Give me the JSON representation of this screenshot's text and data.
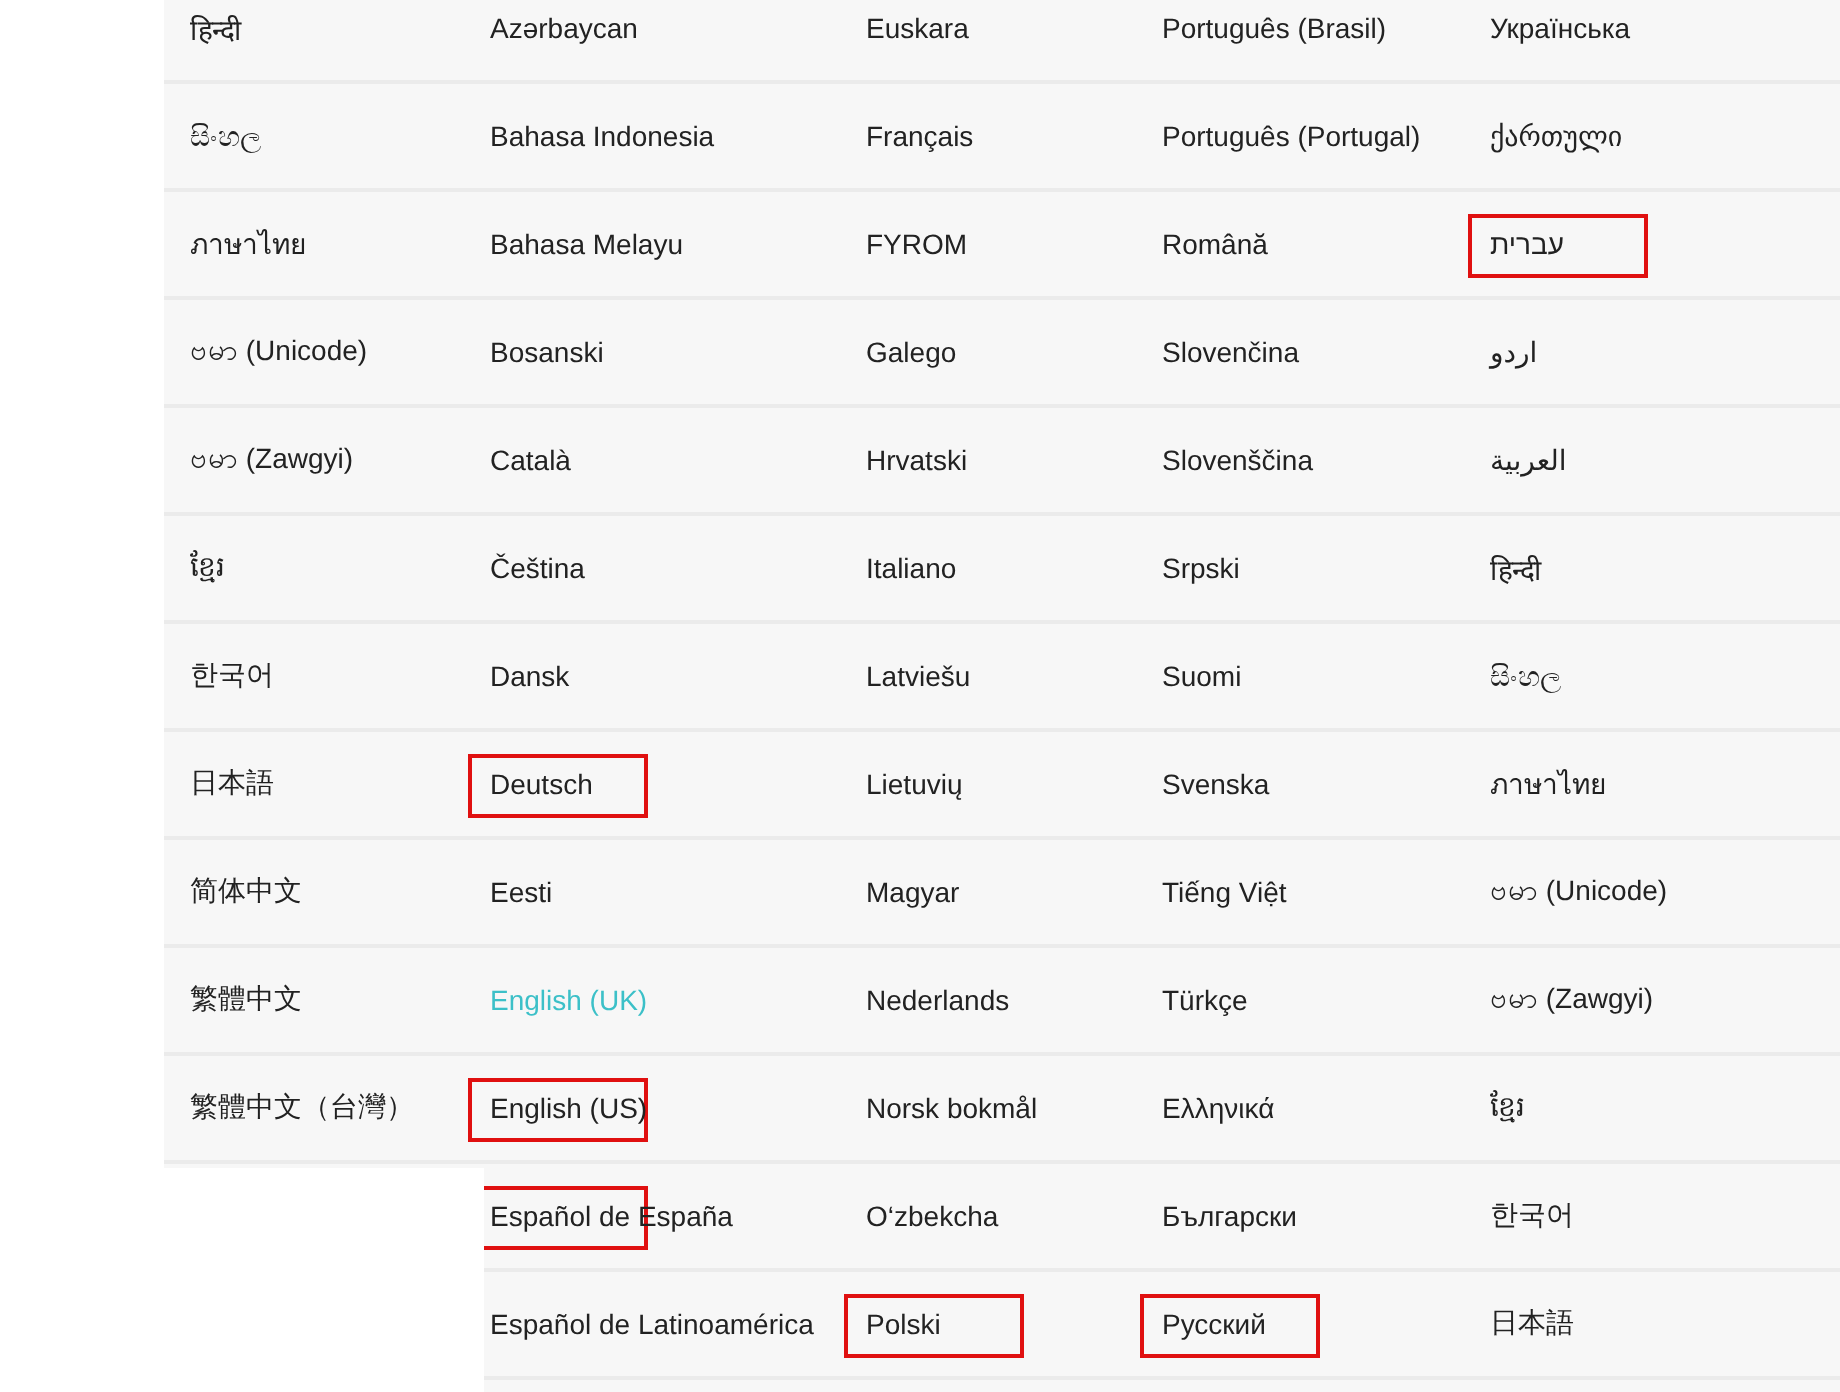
{
  "columns": [
    {
      "items": [
        {
          "label": "हिन्दी",
          "selected": false,
          "highlighted": false
        },
        {
          "label": "සිංහල",
          "selected": false,
          "highlighted": false
        },
        {
          "label": "ภาษาไทย",
          "selected": false,
          "highlighted": false
        },
        {
          "label": "ဗမာ (Unicode)",
          "selected": false,
          "highlighted": false
        },
        {
          "label": "ဗမာ (Zawgyi)",
          "selected": false,
          "highlighted": false
        },
        {
          "label": "ខ្មែរ",
          "selected": false,
          "highlighted": false
        },
        {
          "label": "한국어",
          "selected": false,
          "highlighted": false
        },
        {
          "label": "日本語",
          "selected": false,
          "highlighted": false
        },
        {
          "label": "简体中文",
          "selected": false,
          "highlighted": false
        },
        {
          "label": "繁體中文",
          "selected": false,
          "highlighted": false
        },
        {
          "label": "繁體中文（台灣）",
          "selected": false,
          "highlighted": false
        }
      ]
    },
    {
      "items": [
        {
          "label": "Azərbaycan",
          "selected": false,
          "highlighted": false
        },
        {
          "label": "Bahasa Indonesia",
          "selected": false,
          "highlighted": false
        },
        {
          "label": "Bahasa Melayu",
          "selected": false,
          "highlighted": false
        },
        {
          "label": "Bosanski",
          "selected": false,
          "highlighted": false
        },
        {
          "label": "Català",
          "selected": false,
          "highlighted": false
        },
        {
          "label": "Čeština",
          "selected": false,
          "highlighted": false
        },
        {
          "label": "Dansk",
          "selected": false,
          "highlighted": false
        },
        {
          "label": "Deutsch",
          "selected": false,
          "highlighted": true
        },
        {
          "label": "Eesti",
          "selected": false,
          "highlighted": false
        },
        {
          "label": "English (UK)",
          "selected": true,
          "highlighted": false
        },
        {
          "label": "English (US)",
          "selected": false,
          "highlighted": true
        },
        {
          "label": "Español de España",
          "selected": false,
          "highlighted": true
        },
        {
          "label": "Español de Latinoamérica",
          "selected": false,
          "highlighted": false
        }
      ]
    },
    {
      "items": [
        {
          "label": "Euskara",
          "selected": false,
          "highlighted": false
        },
        {
          "label": "Français",
          "selected": false,
          "highlighted": false
        },
        {
          "label": "FYROM",
          "selected": false,
          "highlighted": false
        },
        {
          "label": "Galego",
          "selected": false,
          "highlighted": false
        },
        {
          "label": "Hrvatski",
          "selected": false,
          "highlighted": false
        },
        {
          "label": "Italiano",
          "selected": false,
          "highlighted": false
        },
        {
          "label": "Latviešu",
          "selected": false,
          "highlighted": false
        },
        {
          "label": "Lietuvių",
          "selected": false,
          "highlighted": false
        },
        {
          "label": "Magyar",
          "selected": false,
          "highlighted": false
        },
        {
          "label": "Nederlands",
          "selected": false,
          "highlighted": false
        },
        {
          "label": "Norsk bokmål",
          "selected": false,
          "highlighted": false
        },
        {
          "label": "O‘zbekcha",
          "selected": false,
          "highlighted": false
        },
        {
          "label": "Polski",
          "selected": false,
          "highlighted": true
        }
      ]
    },
    {
      "items": [
        {
          "label": "Português (Brasil)",
          "selected": false,
          "highlighted": false
        },
        {
          "label": "Português (Portugal)",
          "selected": false,
          "highlighted": false
        },
        {
          "label": "Română",
          "selected": false,
          "highlighted": false
        },
        {
          "label": "Slovenčina",
          "selected": false,
          "highlighted": false
        },
        {
          "label": "Slovenščina",
          "selected": false,
          "highlighted": false
        },
        {
          "label": "Srpski",
          "selected": false,
          "highlighted": false
        },
        {
          "label": "Suomi",
          "selected": false,
          "highlighted": false
        },
        {
          "label": "Svenska",
          "selected": false,
          "highlighted": false
        },
        {
          "label": "Tiếng Việt",
          "selected": false,
          "highlighted": false
        },
        {
          "label": "Türkçe",
          "selected": false,
          "highlighted": false
        },
        {
          "label": "Ελληνικά",
          "selected": false,
          "highlighted": false
        },
        {
          "label": "Български",
          "selected": false,
          "highlighted": false
        },
        {
          "label": "Русский",
          "selected": false,
          "highlighted": true
        }
      ]
    },
    {
      "items": [
        {
          "label": "Українська",
          "selected": false,
          "highlighted": false
        },
        {
          "label": "ქართული",
          "selected": false,
          "highlighted": false
        },
        {
          "label": "עברית",
          "selected": false,
          "highlighted": true
        },
        {
          "label": "اردو",
          "selected": false,
          "highlighted": false
        },
        {
          "label": "العربية",
          "selected": false,
          "highlighted": false
        },
        {
          "label": "हिन्दी",
          "selected": false,
          "highlighted": false
        },
        {
          "label": "සිංහල",
          "selected": false,
          "highlighted": false
        },
        {
          "label": "ภาษาไทย",
          "selected": false,
          "highlighted": false
        },
        {
          "label": "ဗမာ (Unicode)",
          "selected": false,
          "highlighted": false
        },
        {
          "label": "ဗမာ (Zawgyi)",
          "selected": false,
          "highlighted": false
        },
        {
          "label": "ខ្មែរ",
          "selected": false,
          "highlighted": false
        },
        {
          "label": "한국어",
          "selected": false,
          "highlighted": false
        },
        {
          "label": "日本語",
          "selected": false,
          "highlighted": false
        }
      ]
    }
  ]
}
